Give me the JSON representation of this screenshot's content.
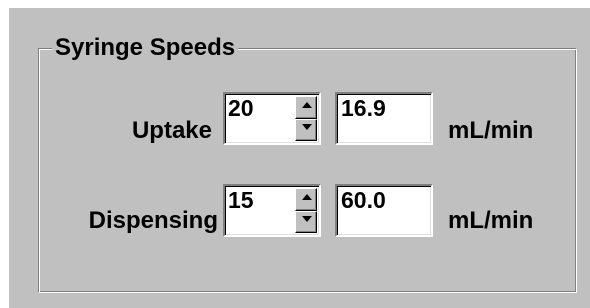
{
  "group": {
    "title": "Syringe Speeds"
  },
  "rows": [
    {
      "label": "Uptake",
      "spin_value": "20",
      "rate_value": "16.9",
      "unit": "mL/min"
    },
    {
      "label": "Dispensing",
      "spin_value": "15",
      "rate_value": "60.0",
      "unit": "mL/min"
    }
  ],
  "icons": {
    "spin_up": "arrow-up-icon",
    "spin_down": "arrow-down-icon"
  },
  "colors": {
    "panel_background": "#c0c0c0",
    "field_background": "#ffffff",
    "text": "#000000"
  }
}
